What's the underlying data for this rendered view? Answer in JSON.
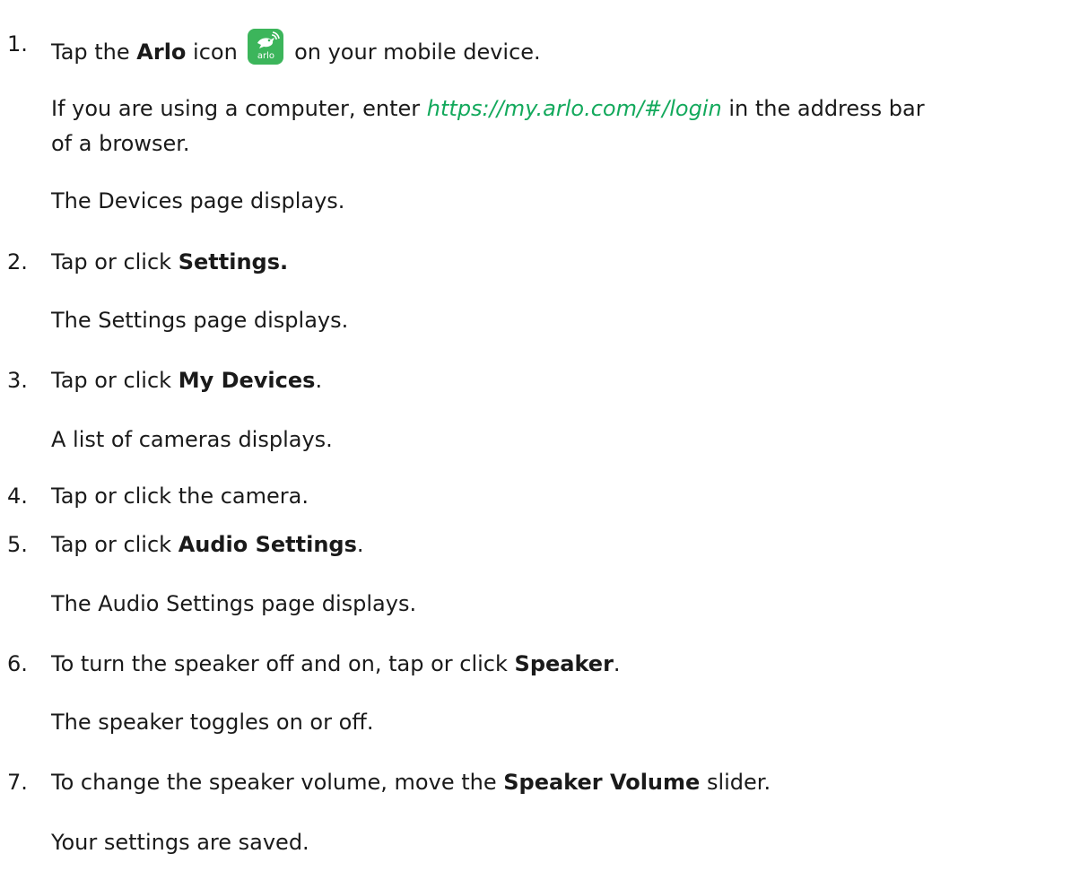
{
  "steps": [
    {
      "num": "1.",
      "pre": "Tap the ",
      "bold": "Arlo",
      "mid": " icon",
      "post": " on your mobile device.",
      "icon_label": "arlo",
      "note_pre": "If you are using a computer, enter ",
      "note_link": "https://my.arlo.com/#/login",
      "note_post": " in the address bar",
      "note_line2": "of a browser.",
      "result": "The Devices page displays."
    },
    {
      "num": "2.",
      "pre": "Tap or click ",
      "bold": "Settings.",
      "post": "",
      "result": "The Settings page displays."
    },
    {
      "num": "3.",
      "pre": "Tap or click ",
      "bold": "My Devices",
      "post": ".",
      "result": "A list of cameras displays."
    },
    {
      "num": "4.",
      "pre": "Tap or click the camera.",
      "bold": "",
      "post": ""
    },
    {
      "num": "5.",
      "pre": "Tap or click ",
      "bold": "Audio Settings",
      "post": ".",
      "result": "The Audio Settings page displays."
    },
    {
      "num": "6.",
      "pre": "To turn the speaker off and on, tap or click ",
      "bold": "Speaker",
      "post": ".",
      "result": "The speaker toggles on or off."
    },
    {
      "num": "7.",
      "pre": "To change the speaker volume, move the ",
      "bold": "Speaker Volume",
      "post": " slider.",
      "result": "Your settings are saved."
    }
  ],
  "colors": {
    "link": "#13a95c",
    "icon_bg": "#3cb55b"
  }
}
